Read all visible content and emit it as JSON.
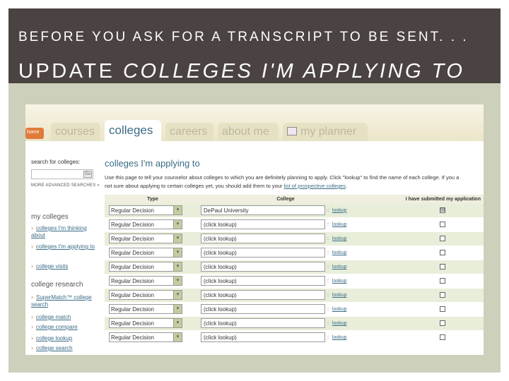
{
  "slide": {
    "title_line1": "BEFORE YOU ASK FOR A TRANSCRIPT TO BE SENT. . .",
    "title_line2_prefix": "UPDATE ",
    "title_line2_emphasis": "COLLEGES I'M APPLYING TO"
  },
  "tabs": [
    {
      "label": "home"
    },
    {
      "label": "courses"
    },
    {
      "label": "colleges"
    },
    {
      "label": "careers"
    },
    {
      "label": "about me"
    },
    {
      "label": "my planner"
    }
  ],
  "sidebar": {
    "search_label": "search for colleges:",
    "search_go": "Go",
    "advanced_link": "MORE ADVANCED SEARCHES »",
    "my_colleges_heading": "my colleges",
    "my_colleges": [
      {
        "label": "colleges I'm thinking about"
      },
      {
        "label": "colleges I'm applying to"
      },
      {
        "label": "college visits"
      }
    ],
    "research_heading": "college research",
    "research": [
      {
        "label": "SuperMatch™ college search"
      },
      {
        "label": "college match"
      },
      {
        "label": "college compare"
      },
      {
        "label": "college lookup"
      },
      {
        "label": "college search"
      }
    ]
  },
  "main": {
    "title": "colleges I'm applying to",
    "instructions_line1": "Use this page to tell your counselor about colleges to which you are definitely planning to apply. Click \"lookup\" to find the name of each college. If you a",
    "instructions_line2_pre": "not sure about applying to certain colleges yet, you should add them to your ",
    "instructions_link": "list of prospective colleges",
    "instructions_line2_post": ".",
    "columns": {
      "type": "Type",
      "college": "College",
      "submitted": "I have submitted my application"
    },
    "rows": [
      {
        "type": "Regular Decision",
        "college": "DePaul University",
        "lookup": "lookup",
        "submitted": "☒"
      },
      {
        "type": "Regular Decision",
        "college": "(click lookup)",
        "lookup": "lookup",
        "submitted": ""
      },
      {
        "type": "Regular Decision",
        "college": "(click lookup)",
        "lookup": "lookup",
        "submitted": ""
      },
      {
        "type": "Regular Decision",
        "college": "(click lookup)",
        "lookup": "lookup",
        "submitted": ""
      },
      {
        "type": "Regular Decision",
        "college": "(click lookup)",
        "lookup": "lookup",
        "submitted": ""
      },
      {
        "type": "Regular Decision",
        "college": "(click lookup)",
        "lookup": "lookup",
        "submitted": ""
      },
      {
        "type": "Regular Decision",
        "college": "(click lookup)",
        "lookup": "lookup",
        "submitted": ""
      },
      {
        "type": "Regular Decision",
        "college": "(click lookup)",
        "lookup": "lookup",
        "submitted": ""
      },
      {
        "type": "Regular Decision",
        "college": "(click lookup)",
        "lookup": "lookup",
        "submitted": ""
      },
      {
        "type": "Regular Decision",
        "college": "(click lookup)",
        "lookup": "lookup",
        "submitted": ""
      }
    ]
  },
  "colors": {
    "title_band": "#4a4341",
    "frame": "#cdd0bb",
    "accent_link": "#3a6c86",
    "accent_orange": "#e07b3a",
    "row_tint": "#e8eed9"
  }
}
